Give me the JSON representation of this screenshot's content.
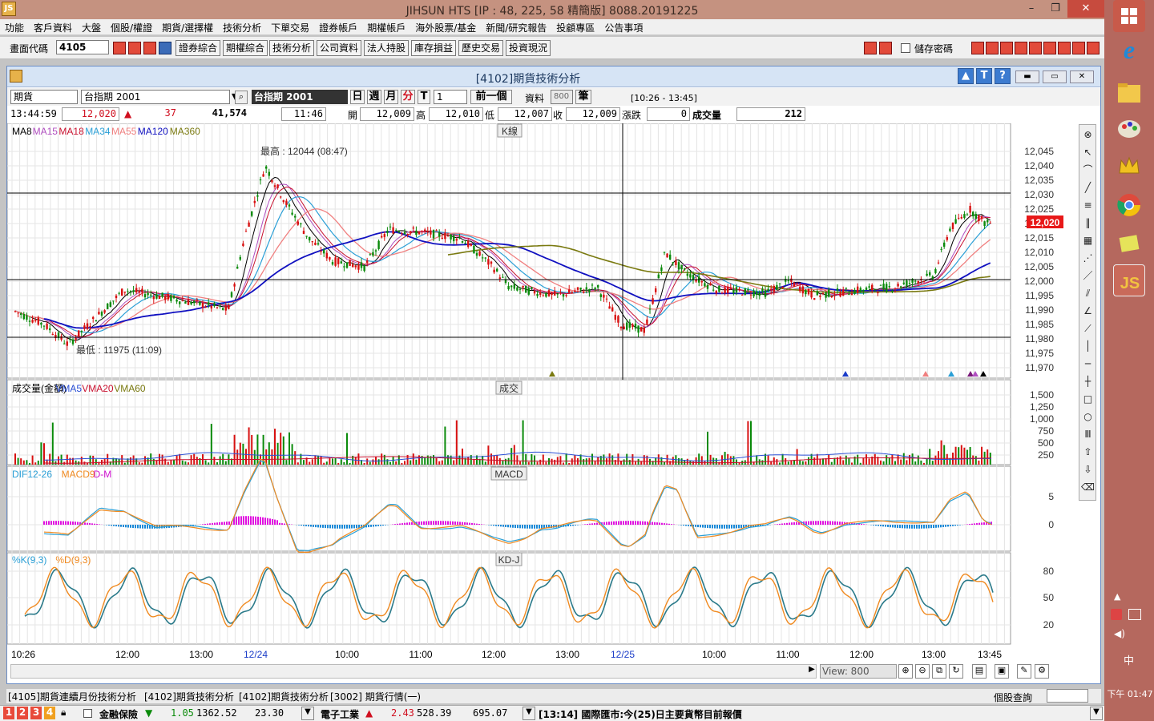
{
  "window": {
    "title": "JIHSUN HTS     [IP : 48, 225, 58 精簡版] 8088.20191225",
    "min": "–",
    "max": "❐",
    "close": "✕"
  },
  "menu": [
    "功能",
    "客戶資料",
    "大盤",
    "個股/權證",
    "期貨/選擇權",
    "技術分析",
    "下單交易",
    "證券帳戶",
    "期權帳戶",
    "海外股票/基金",
    "新聞/研究報告",
    "投顧專區",
    "公告事項"
  ],
  "toolbar": {
    "code_label": "畫面代碼",
    "code_value": "4105",
    "buttons": [
      "證券綜合",
      "期權綜合",
      "技術分析",
      "公司資料",
      "法人持股",
      "庫存損益",
      "歷史交易",
      "投資現況"
    ],
    "save_pw": "儲存密碼"
  },
  "inner": {
    "title": "[4102]期貨技術分析",
    "help": "?",
    "t": "T"
  },
  "controls": {
    "type": "期貨",
    "symbol": "台指期 2001",
    "symbol_dark": "台指期 2001",
    "periods": [
      "日",
      "週",
      "月",
      "分",
      "T"
    ],
    "interval": "1",
    "prev": "前一個",
    "data_label": "資料",
    "data_count": "800",
    "unit": "筆",
    "range": "[10:26 - 13:45]"
  },
  "info": {
    "time": "13:44:59",
    "price": "12,020",
    "change": "37",
    "volume_total": "41,574",
    "bar_time": "11:46",
    "open_label": "開",
    "open": "12,009",
    "high_label": "高",
    "high": "12,010",
    "low_label": "低",
    "low": "12,007",
    "close_label": "收",
    "close": "12,009",
    "chg_label": "漲跌",
    "chg": "0",
    "vol_label": "成交量",
    "vol": "212"
  },
  "panels": {
    "k": {
      "title": "K線",
      "legend": [
        {
          "t": "MA8",
          "c": "#000000"
        },
        {
          "t": "MA15",
          "c": "#b04fc0"
        },
        {
          "t": "MA18",
          "c": "#c8102e"
        },
        {
          "t": "MA34",
          "c": "#2a9fd6"
        },
        {
          "t": "MA55",
          "c": "#f08080"
        },
        {
          "t": "MA120",
          "c": "#1010c0"
        },
        {
          "t": "MA360",
          "c": "#7a7a10"
        }
      ],
      "high_note": "最高 : 12044 (08:47)",
      "low_note": "最低 : 11975 (11:09)",
      "price_tag": "12,020",
      "yticks": [
        "12,045",
        "12,040",
        "12,035",
        "12,030",
        "12,025",
        "12,020",
        "12,015",
        "12,010",
        "12,005",
        "12,000",
        "11,995",
        "11,990",
        "11,985",
        "11,980",
        "11,975",
        "11,970"
      ]
    },
    "vol": {
      "title": "成交",
      "legend": [
        {
          "t": "成交量(金額)",
          "c": "#000000"
        },
        {
          "t": "VMA5",
          "c": "#2a4fd6"
        },
        {
          "t": "VMA20",
          "c": "#c8102e"
        },
        {
          "t": "VMA60",
          "c": "#7a7a10"
        }
      ],
      "yticks": [
        "1,500",
        "1,250",
        "1,000",
        "750",
        "500",
        "250"
      ]
    },
    "macd": {
      "title": "MACD",
      "legend": [
        {
          "t": "DIF12-26",
          "c": "#2a9fd6"
        },
        {
          "t": "MACD9",
          "c": "#f08a20"
        },
        {
          "t": "D-M",
          "c": "#d010d0"
        }
      ],
      "yticks": [
        "5",
        "0"
      ]
    },
    "kd": {
      "title": "KD-J",
      "legend": [
        {
          "t": "%K(9,3)",
          "c": "#2a9fd6"
        },
        {
          "t": "%D(9,3)",
          "c": "#f08a20"
        }
      ],
      "yticks": [
        "80",
        "50",
        "20"
      ]
    }
  },
  "xticks": [
    {
      "t": "10:26",
      "c": "#000"
    },
    {
      "t": "12:00",
      "c": "#000"
    },
    {
      "t": "13:00",
      "c": "#000"
    },
    {
      "t": "12/24",
      "c": "#1a3cc8"
    },
    {
      "t": "10:00",
      "c": "#000"
    },
    {
      "t": "11:00",
      "c": "#000"
    },
    {
      "t": "12:00",
      "c": "#000"
    },
    {
      "t": "13:00",
      "c": "#000"
    },
    {
      "t": "12/25",
      "c": "#1a3cc8"
    },
    {
      "t": "10:00",
      "c": "#000"
    },
    {
      "t": "11:00",
      "c": "#000"
    },
    {
      "t": "12:00",
      "c": "#000"
    },
    {
      "t": "13:00",
      "c": "#000"
    },
    {
      "t": "13:45",
      "c": "#000"
    }
  ],
  "view_label": "View: 800",
  "tabs": [
    "[4105]期貨連續月份技術分析",
    "[4102]期貨技術分析",
    "[4102]期貨技術分析",
    "[3002] 期貨行情(一)"
  ],
  "stock_query": "個股查詢",
  "status": {
    "nums": [
      "1",
      "2",
      "3",
      "4"
    ],
    "sector1": "金融保險",
    "s1_arrow": "▼",
    "s1_chg": "1.05",
    "s1_idx": "1362.52",
    "s1_vol": "23.30",
    "sector2": "電子工業",
    "s2_arrow": "▲",
    "s2_chg": "2.43",
    "s2_idx": "528.39",
    "s2_vol": "695.07",
    "news": "[13:14] 國際匯市:今(25)日主要貨幣目前報價"
  },
  "taskbar": {
    "time": "下午 01:47",
    "ime": "中"
  }
}
